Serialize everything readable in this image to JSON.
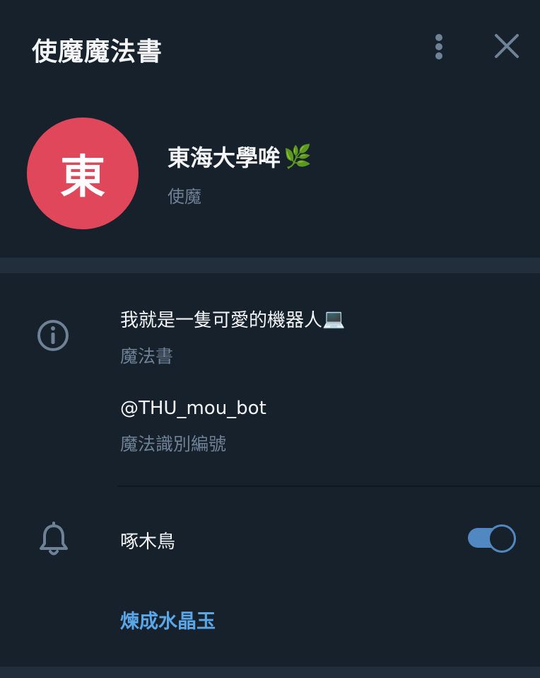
{
  "header": {
    "title": "使魔魔法書",
    "menu_icon": "more-vertical-icon",
    "close_icon": "close-icon"
  },
  "profile": {
    "avatar_letter": "東",
    "avatar_color": "#e0475a",
    "name": "東海大學哞",
    "name_emoji": "🌿",
    "role": "使魔"
  },
  "info": {
    "bio": "我就是一隻可愛的機器人",
    "bio_emoji": "💻",
    "bio_label": "魔法書",
    "username": "@THU_mou_bot",
    "username_label": "魔法識別編號"
  },
  "notifications": {
    "label": "啄木鳥",
    "enabled": true,
    "accent_color": "#5288c1"
  },
  "action": {
    "label": "煉成水晶玉",
    "color": "#5aa7e8"
  }
}
